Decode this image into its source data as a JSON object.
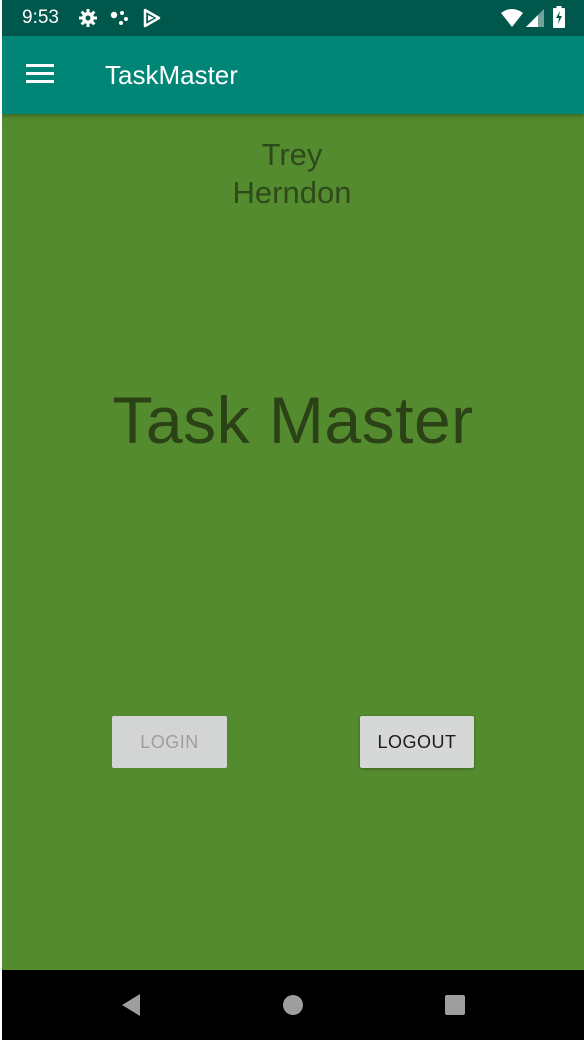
{
  "status_bar": {
    "time": "9:53",
    "icons": [
      "gear-icon",
      "dots-icon",
      "play-protect-icon",
      "wifi-icon",
      "signal-icon",
      "battery-icon"
    ]
  },
  "app_bar": {
    "title": "TaskMaster",
    "menu_icon": "hamburger-menu-icon"
  },
  "main": {
    "user_first_name": "Trey",
    "user_last_name": "Herndon",
    "headline": "Task Master",
    "login_label": "LOGIN",
    "logout_label": "LOGOUT"
  },
  "nav_bar": {
    "icons": [
      "back-icon",
      "home-icon",
      "recents-icon"
    ]
  },
  "colors": {
    "status_bar": "#00574b",
    "app_bar": "#008577",
    "background": "#558b2f",
    "button": "#d6d7d7"
  }
}
